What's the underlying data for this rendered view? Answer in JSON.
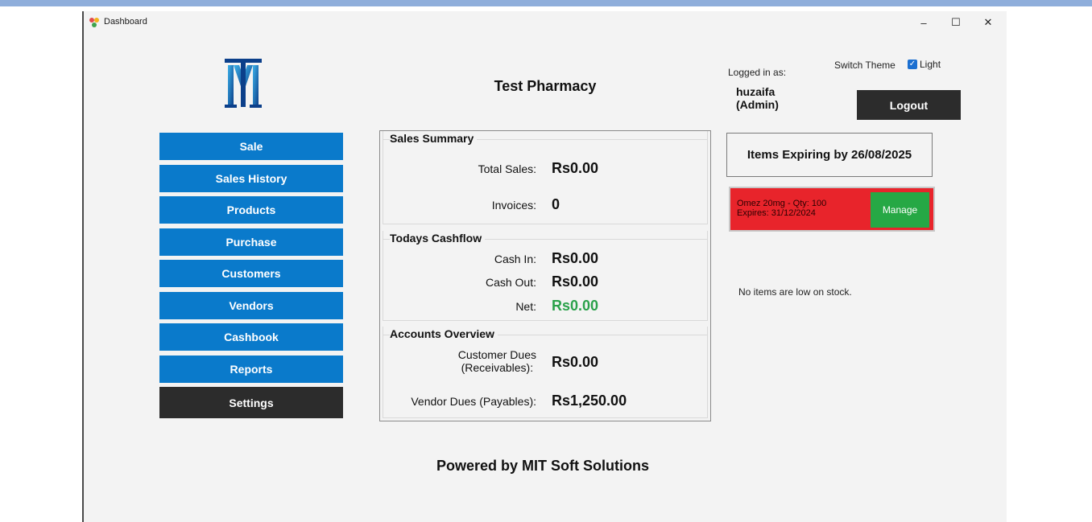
{
  "window": {
    "title": "Dashboard",
    "minimize": "–",
    "maximize": "☐",
    "close": "✕"
  },
  "header": {
    "shop_name": "Test Pharmacy"
  },
  "nav": [
    {
      "label": "Sale"
    },
    {
      "label": "Sales History"
    },
    {
      "label": "Products"
    },
    {
      "label": "Purchase"
    },
    {
      "label": "Customers"
    },
    {
      "label": "Vendors"
    },
    {
      "label": "Cashbook"
    },
    {
      "label": "Reports"
    },
    {
      "label": "Settings"
    }
  ],
  "sales_summary": {
    "title": "Sales Summary",
    "total_sales_label": "Total Sales:",
    "total_sales_value": "Rs0.00",
    "invoices_label": "Invoices:",
    "invoices_value": "0"
  },
  "cashflow": {
    "title": "Todays Cashflow",
    "cash_in_label": "Cash In:",
    "cash_in_value": "Rs0.00",
    "cash_out_label": "Cash Out:",
    "cash_out_value": "Rs0.00",
    "net_label": "Net:",
    "net_value": "Rs0.00"
  },
  "accounts": {
    "title": "Accounts Overview",
    "customer_dues_label_1": "Customer Dues",
    "customer_dues_label_2": "(Receivables):",
    "customer_dues_value": "Rs0.00",
    "vendor_dues_label": "Vendor Dues (Payables):",
    "vendor_dues_value": "Rs1,250.00"
  },
  "user": {
    "logged_in_label": "Logged in as:",
    "name": "huzaifa",
    "role": "(Admin)",
    "logout_label": "Logout"
  },
  "theme": {
    "switch_label": "Switch Theme",
    "value": "Light",
    "checked": true
  },
  "expiry": {
    "header": "Items Expiring by 26/08/2025",
    "items": [
      {
        "line1": "Omez 20mg - Qty: 100",
        "line2": "Expires: 31/12/2024",
        "action": "Manage"
      }
    ]
  },
  "low_stock": {
    "message": "No items are low on stock."
  },
  "footer": {
    "text": "Powered by MIT Soft Solutions"
  },
  "colors": {
    "nav_blue": "#0a7acb",
    "dark": "#2c2c2c",
    "alert_red": "#e8242b",
    "manage_green": "#26a845",
    "net_green": "#2aa14a"
  }
}
